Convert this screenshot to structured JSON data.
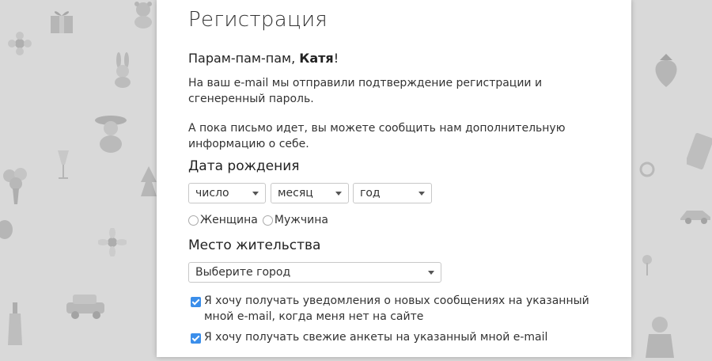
{
  "registration": {
    "title": "Регистрация",
    "greeting_prefix": "Парам-пам-пам, ",
    "user_name": "Катя",
    "greeting_suffix": "!",
    "notice_text": "На ваш e-mail мы отправили подтверждение регистрации и сгенеренный пароль.",
    "info_text": "А пока письмо идет, вы можете сообщить нам дополнительную информацию о себе.",
    "birth_date": {
      "heading": "Дата рождения",
      "day_value": "число",
      "month_value": "месяц",
      "year_value": "год"
    },
    "gender": {
      "female_label": "Женщина",
      "male_label": "Мужчина"
    },
    "residence": {
      "heading": "Место жительства",
      "city_value": "Выберите город"
    },
    "notifications": {
      "messages_label": "Я хочу получать уведомления о новых сообщениях на указанный мной e-mail, когда меня нет на сайте",
      "messages_checked": true,
      "profiles_label": "Я хочу получать свежие анкеты на указанный мной e-mail",
      "profiles_checked": true
    }
  },
  "colors": {
    "background": "#d9d9d9",
    "panel": "#ffffff",
    "checkbox_accent": "#3b8eea"
  }
}
